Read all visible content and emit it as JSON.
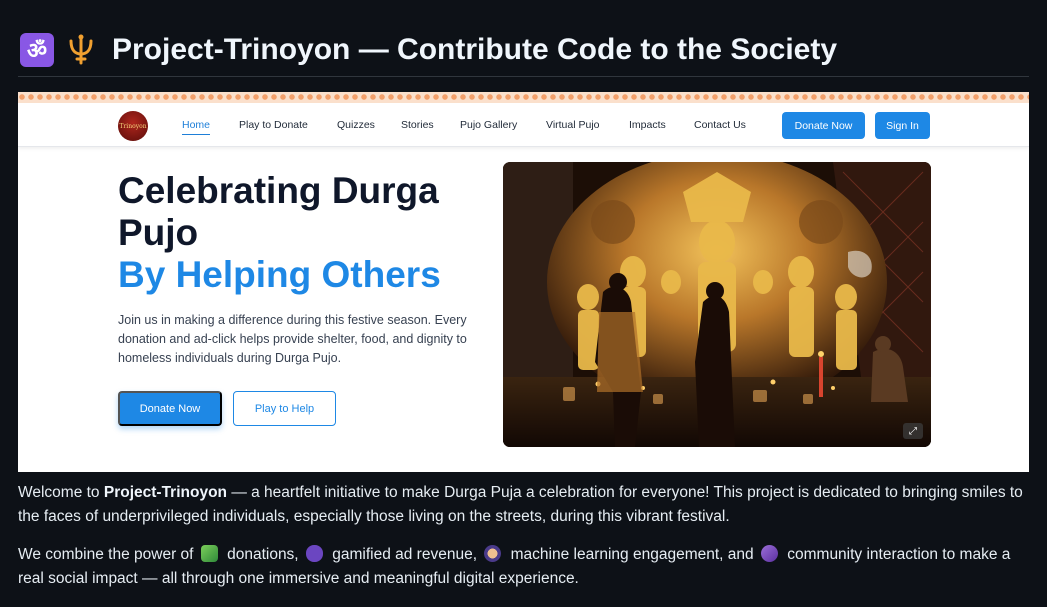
{
  "readme": {
    "title": "Project-Trinoyon — Contribute Code to the Society",
    "badge_icon": "om-symbol-icon",
    "trident_icon": "trident-icon"
  },
  "site": {
    "logo_text": "Trinoyon",
    "nav": {
      "home": "Home",
      "play": "Play to Donate",
      "quizzes": "Quizzes",
      "stories": "Stories",
      "gallery": "Pujo Gallery",
      "virtual": "Virtual Pujo",
      "impacts": "Impacts",
      "contact": "Contact Us",
      "donate": "Donate Now",
      "signin": "Sign In"
    },
    "hero": {
      "heading": "Celebrating Durga Pujo",
      "subheading": "By Helping Others",
      "description": "Join us in making a difference during this festive season. Every donation and ad-click helps provide shelter, food, and dignity to homeless individuals during Durga Pujo.",
      "donate_button": "Donate Now",
      "play_button": "Play to Help",
      "expand_icon": "⤢"
    }
  },
  "paragraphs": {
    "p1": {
      "lead": "Welcome to ",
      "name": "Project-Trinoyon",
      "rest": " — a heartfelt initiative to make Durga Puja a celebration for everyone! This project is dedicated to bringing smiles to the faces of underprivileged individuals, especially those living on the streets, during this vibrant festival."
    },
    "p2": {
      "a": "We combine the power of ",
      "b": " donations, ",
      "c": " gamified ad revenue, ",
      "d": " machine learning engagement, and ",
      "e": " community interaction to make a real social impact — all through one immersive and meaningful digital experience."
    }
  },
  "colors": {
    "accent": "#1e88e5",
    "background": "#0d1117"
  }
}
